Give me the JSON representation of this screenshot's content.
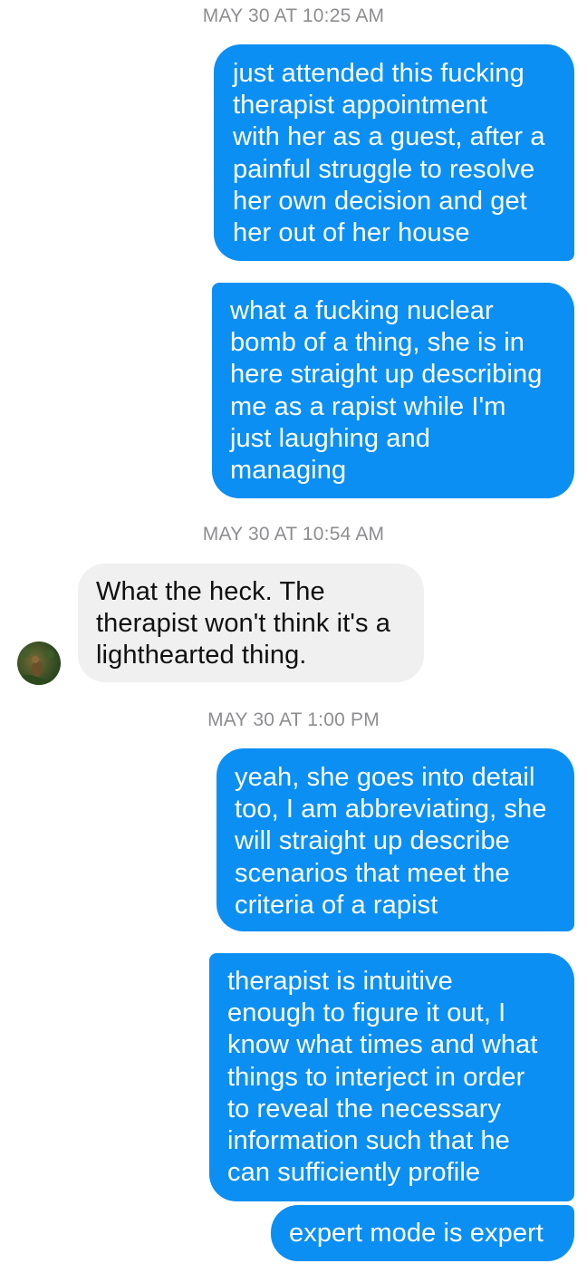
{
  "thread": {
    "timestamps": {
      "t1": "MAY 30 AT 10:25 AM",
      "t2": "MAY 30 AT 10:54 AM",
      "t3": "MAY 30 AT 1:00 PM"
    },
    "messages": {
      "m1": "just attended this fucking\ntherapist appointment\nwith her as a guest, after a\npainful struggle to resolve\nher own decision and get\nher out of her house",
      "m2": "what a fucking nuclear\nbomb of a thing, she is in\nhere straight up describing\nme as a rapist while I'm\njust laughing and\nmanaging",
      "m3": "What the heck. The\ntherapist won't think it's a\nlighthearted thing.",
      "m4": "yeah, she goes into detail\ntoo, I am abbreviating, she\nwill straight up describe\nscenarios that meet the\ncriteria of a rapist",
      "m5": "therapist is intuitive\nenough to figure it out, I\nknow what times and what\nthings to interject in order\nto reveal the necessary\ninformation such that he\ncan sufficiently profile",
      "m6": "expert mode is expert"
    }
  },
  "colors": {
    "outgoing_bubble": "#0b8ff3",
    "incoming_bubble": "#f0f0f0",
    "timestamp_text": "#8d8d92"
  },
  "icons": {
    "avatar": "contact-avatar-photo"
  }
}
